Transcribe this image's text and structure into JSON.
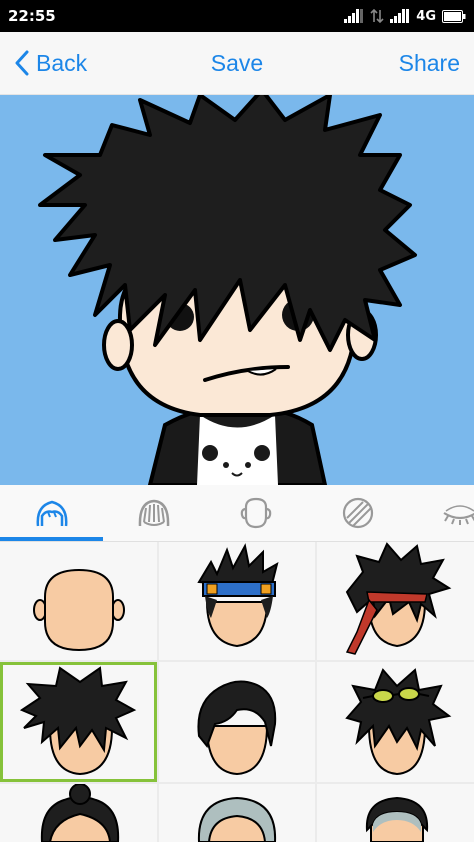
{
  "status_bar": {
    "time": "22:55",
    "network": "4G",
    "icons": [
      "signal-icon",
      "data-off-icon",
      "signal-icon",
      "battery-icon"
    ]
  },
  "nav": {
    "back_label": "Back",
    "save_label": "Save",
    "share_label": "Share"
  },
  "tabs": [
    {
      "icon": "hair-icon",
      "selected": true
    },
    {
      "icon": "hair-strands-icon",
      "selected": false
    },
    {
      "icon": "face-shape-icon",
      "selected": false
    },
    {
      "icon": "striped-ball-icon",
      "selected": false
    },
    {
      "icon": "eye-lash-icon",
      "selected": false
    }
  ],
  "hair_options": [
    {
      "name": "bald",
      "selected": false
    },
    {
      "name": "ninja-headband",
      "selected": false
    },
    {
      "name": "spiky-red-bandana",
      "selected": false
    },
    {
      "name": "messy-spiky",
      "selected": true
    },
    {
      "name": "side-parted",
      "selected": false
    },
    {
      "name": "spiky-goggles",
      "selected": false
    },
    {
      "name": "bun",
      "selected": false
    },
    {
      "name": "grey-hair",
      "selected": false
    },
    {
      "name": "buzz-grey",
      "selected": false
    }
  ],
  "colors": {
    "accent": "#1c86e8",
    "canvas_bg": "#7ab8ec",
    "selection": "#86c23a",
    "skin": "#f7cba3",
    "hair": "#1e1e1e"
  }
}
